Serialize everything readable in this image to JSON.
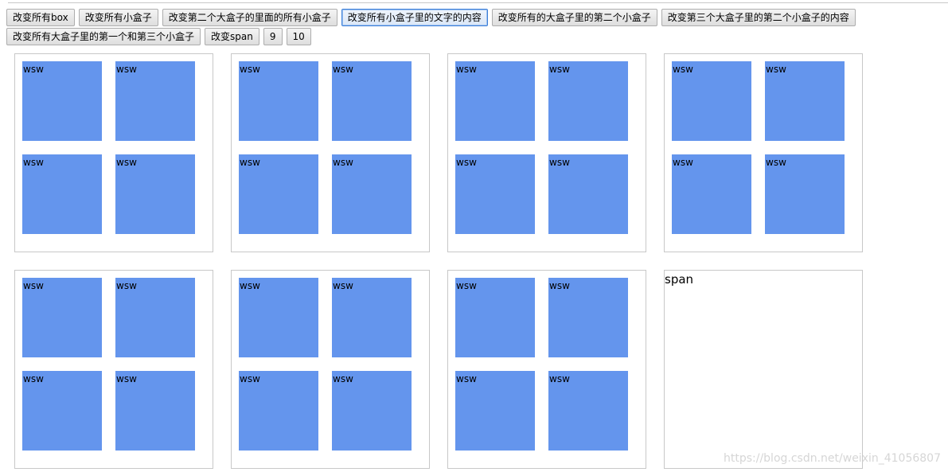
{
  "toolbar": {
    "row1": [
      "改变所有box",
      "改变所有小盒子",
      "改变第二个大盒子的里面的所有小盒子",
      "改变所有小盒子里的文字的内容",
      "改变所有的大盒子里的第二个小盒子",
      "改变第三个大盒子里的第二个小盒子的内容"
    ],
    "row2": [
      "改变所有大盒子里的第一个和第三个小盒子",
      "改变span",
      "9",
      "10"
    ],
    "focused_button": "改变所有小盒子里的文字的内容"
  },
  "small_box_text": "wsw",
  "span_text": "span",
  "watermark": "https://blog.csdn.net/weixin_41056807",
  "colors": {
    "small_box": "#6495ed",
    "big_box_border": "#c8c8c8"
  }
}
